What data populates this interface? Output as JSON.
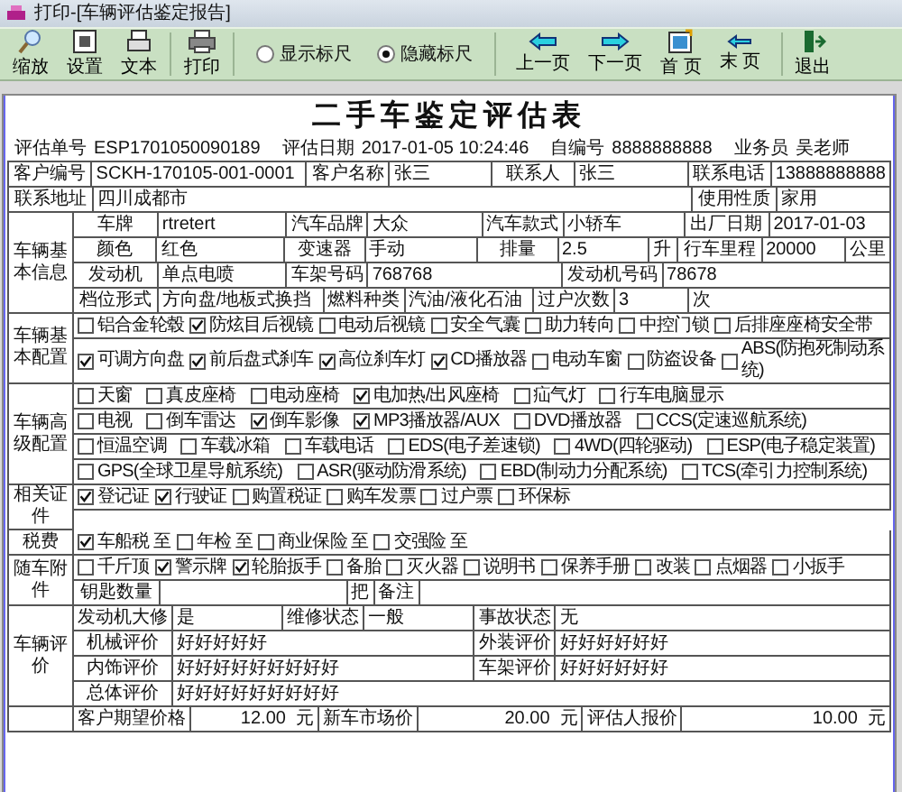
{
  "window": {
    "title": "打印-[车辆评估鉴定报告]"
  },
  "toolbar": {
    "groups": [
      [
        {
          "kind": "zoom",
          "label": "缩放"
        },
        {
          "kind": "settings",
          "label": "设置"
        },
        {
          "kind": "text",
          "label": "文本"
        }
      ],
      [
        {
          "kind": "print",
          "label": "打印"
        }
      ]
    ],
    "ruler_options": [
      {
        "label": "显示标尺",
        "selected": false
      },
      {
        "label": "隐藏标尺",
        "selected": true
      }
    ],
    "nav": [
      {
        "kind": "prev",
        "label": "上一页"
      },
      {
        "kind": "next",
        "label": "下一页"
      },
      {
        "kind": "first",
        "label": "首  页"
      },
      {
        "kind": "last",
        "label": "末  页"
      }
    ],
    "exit": {
      "kind": "exit",
      "label": "退出"
    }
  },
  "report": {
    "title": "二手车鉴定评估表",
    "header": [
      {
        "label": "评估单号",
        "value": "ESP1701050090189"
      },
      {
        "label": "评估日期",
        "value": "2017-01-05 10:24:46"
      },
      {
        "label": "自编号",
        "value": "8888888888"
      },
      {
        "label": "业务员",
        "value": "吴老师"
      }
    ],
    "customer_rows": [
      [
        {
          "label": "客户编号",
          "value": "SCKH-170105-001-0001"
        },
        {
          "label": "客户名称",
          "value": "张三"
        },
        {
          "label": "联系人",
          "value": "张三"
        },
        {
          "label": "联系电话",
          "value": "13888888888"
        }
      ],
      [
        {
          "label": "联系地址",
          "value": "四川成都市"
        },
        {
          "label": "使用性质",
          "value": "家用"
        }
      ]
    ],
    "sections": [
      {
        "label": "车辆基本信息",
        "rows": [
          {
            "kind": "fields",
            "fields": [
              {
                "label": "车牌",
                "value": "rtretert"
              },
              {
                "label": "汽车品牌",
                "value": "大众"
              },
              {
                "label": "汽车款式",
                "value": "小轿车"
              },
              {
                "label": "出厂日期",
                "value": "2017-01-03"
              }
            ]
          },
          {
            "kind": "fields",
            "fields": [
              {
                "label": "颜色",
                "value": "红色"
              },
              {
                "label": "变速器",
                "value": "手动"
              },
              {
                "label": "排量",
                "value": "2.5",
                "unit": "升"
              },
              {
                "label": "行车里程",
                "value": "20000",
                "unit": "公里"
              }
            ]
          },
          {
            "kind": "fields",
            "fields": [
              {
                "label": "发动机",
                "value": "单点电喷"
              },
              {
                "label": "车架号码",
                "value": "768768"
              },
              {
                "label": "发动机号码",
                "value": "78678"
              }
            ]
          },
          {
            "kind": "fields",
            "fields": [
              {
                "label": "档位形式",
                "value": "方向盘/地板式换挡"
              },
              {
                "label": "燃料种类",
                "value": "汽油/液化石油"
              },
              {
                "label": "过户次数",
                "value": "3",
                "unit": "次"
              }
            ]
          }
        ]
      },
      {
        "label": "车辆基本配置",
        "rows": [
          {
            "kind": "checks",
            "items": [
              {
                "label": "铝合金轮毂",
                "checked": false
              },
              {
                "label": "防炫目后视镜",
                "checked": true
              },
              {
                "label": "电动后视镜",
                "checked": false
              },
              {
                "label": "安全气囊",
                "checked": false
              },
              {
                "label": "助力转向",
                "checked": false
              },
              {
                "label": "中控门锁",
                "checked": false
              },
              {
                "label": "后排座座椅安全带",
                "checked": false
              }
            ]
          },
          {
            "kind": "checks",
            "items": [
              {
                "label": "可调方向盘",
                "checked": true
              },
              {
                "label": "前后盘式刹车",
                "checked": true
              },
              {
                "label": "高位刹车灯",
                "checked": true
              },
              {
                "label": "CD播放器",
                "checked": true
              },
              {
                "label": "电动车窗",
                "checked": false
              },
              {
                "label": "防盗设备",
                "checked": false
              },
              {
                "label": "ABS(防抱死制动系统)",
                "checked": false
              }
            ]
          }
        ]
      },
      {
        "label": "车辆高级配置",
        "rows": [
          {
            "kind": "checks",
            "items": [
              {
                "label": "天窗",
                "checked": false
              },
              {
                "label": "真皮座椅",
                "checked": false
              },
              {
                "label": "电动座椅",
                "checked": false
              },
              {
                "label": "电加热/出风座椅",
                "checked": true
              },
              {
                "label": "疝气灯",
                "checked": false
              },
              {
                "label": "行车电脑显示",
                "checked": false
              }
            ]
          },
          {
            "kind": "checks",
            "items": [
              {
                "label": "电视",
                "checked": false
              },
              {
                "label": "倒车雷达",
                "checked": false
              },
              {
                "label": "倒车影像",
                "checked": true
              },
              {
                "label": "MP3播放器/AUX",
                "checked": true
              },
              {
                "label": "DVD播放器",
                "checked": false
              },
              {
                "label": "CCS(定速巡航系统)",
                "checked": false
              }
            ]
          },
          {
            "kind": "checks",
            "items": [
              {
                "label": "恒温空调",
                "checked": false
              },
              {
                "label": "车载冰箱",
                "checked": false
              },
              {
                "label": "车载电话",
                "checked": false
              },
              {
                "label": "EDS(电子差速锁)",
                "checked": false
              },
              {
                "label": "4WD(四轮驱动)",
                "checked": false
              },
              {
                "label": "ESP(电子稳定装置)",
                "checked": false
              }
            ]
          },
          {
            "kind": "checks",
            "items": [
              {
                "label": "GPS(全球卫星导航系统)",
                "checked": false
              },
              {
                "label": "ASR(驱动防滑系统)",
                "checked": false
              },
              {
                "label": "EBD(制动力分配系统)",
                "checked": false
              },
              {
                "label": "TCS(牵引力控制系统)",
                "checked": false
              }
            ]
          }
        ]
      },
      {
        "label": "相关证件",
        "rows": [
          {
            "kind": "checks",
            "items": [
              {
                "label": "登记证",
                "checked": true
              },
              {
                "label": "行驶证",
                "checked": true
              },
              {
                "label": "购置税证",
                "checked": false
              },
              {
                "label": "购车发票",
                "checked": false
              },
              {
                "label": "过户票",
                "checked": false
              },
              {
                "label": "环保标",
                "checked": false
              }
            ]
          }
        ]
      },
      {
        "label": "税费",
        "rows": [
          {
            "kind": "checks",
            "items": [
              {
                "label": "车船税 至",
                "checked": true
              },
              {
                "label": "年检 至",
                "checked": false
              },
              {
                "label": "商业保险 至",
                "checked": false
              },
              {
                "label": "交强险 至",
                "checked": false
              }
            ]
          }
        ]
      },
      {
        "label": "随车附件",
        "rows": [
          {
            "kind": "checks",
            "items": [
              {
                "label": "千斤顶",
                "checked": false
              },
              {
                "label": "警示牌",
                "checked": true
              },
              {
                "label": "轮胎扳手",
                "checked": true
              },
              {
                "label": "备胎",
                "checked": false
              },
              {
                "label": "灭火器",
                "checked": false
              },
              {
                "label": "说明书",
                "checked": false
              },
              {
                "label": "保养手册",
                "checked": false
              },
              {
                "label": "改装",
                "checked": false
              },
              {
                "label": "点烟器",
                "checked": false
              },
              {
                "label": "小扳手",
                "checked": false
              }
            ]
          },
          {
            "kind": "fields",
            "fields": [
              {
                "label": "钥匙数量",
                "unit": "把"
              },
              {
                "label": "备注"
              }
            ]
          }
        ]
      },
      {
        "label": "车辆评价",
        "rows": [
          {
            "kind": "fields",
            "fields": [
              {
                "label": "发动机大修",
                "value": "是"
              },
              {
                "label": "维修状态",
                "value": "一般"
              },
              {
                "label": "事故状态",
                "value": "无"
              }
            ]
          },
          {
            "kind": "fields",
            "fields": [
              {
                "label": "机械评价",
                "value": "好好好好好"
              },
              {
                "label": "外装评价",
                "value": "好好好好好好"
              }
            ]
          },
          {
            "kind": "fields",
            "fields": [
              {
                "label": "内饰评价",
                "value": "好好好好好好好好好"
              },
              {
                "label": "车架评价",
                "value": "好好好好好好"
              }
            ]
          },
          {
            "kind": "fields",
            "fields": [
              {
                "label": "总体评价",
                "value": "好好好好好好好好好"
              }
            ]
          }
        ]
      },
      {
        "rows": [
          {
            "kind": "prices",
            "fields": [
              {
                "label": "客户期望价格",
                "value": "12.00",
                "unit": "元"
              },
              {
                "label": "新车市场价",
                "value": "20.00",
                "unit": "元"
              },
              {
                "label": "评估人报价",
                "value": "10.00",
                "unit": "元"
              }
            ]
          }
        ]
      }
    ]
  }
}
